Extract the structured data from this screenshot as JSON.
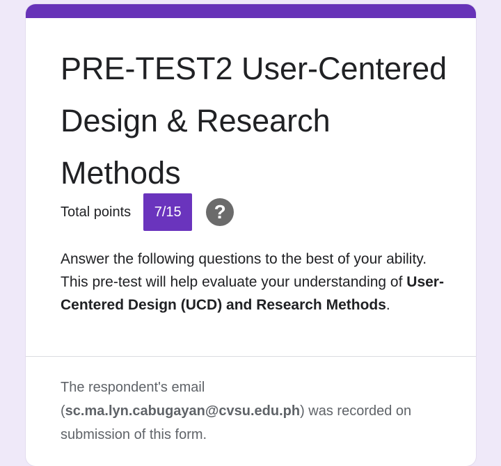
{
  "form": {
    "title": "PRE-TEST2 User-Centered Design & Research Methods",
    "total_points_label": "Total points",
    "score": "7/15",
    "help_icon": "question-mark-icon",
    "description": {
      "lead": " Answer the following questions to the best of your ability. This pre-test will help evaluate your understanding of ",
      "emphasis": "User-Centered Design (UCD) and Research Methods",
      "trail": "."
    },
    "email_note": {
      "before": "The respondent's email (",
      "email": "sc.ma.lyn.cabugayan@cvsu.edu.ph",
      "after": ") was recorded on submission of this form."
    }
  },
  "colors": {
    "accent": "#6733b8",
    "badge": "#6a34bd",
    "background": "#efe9f9"
  }
}
